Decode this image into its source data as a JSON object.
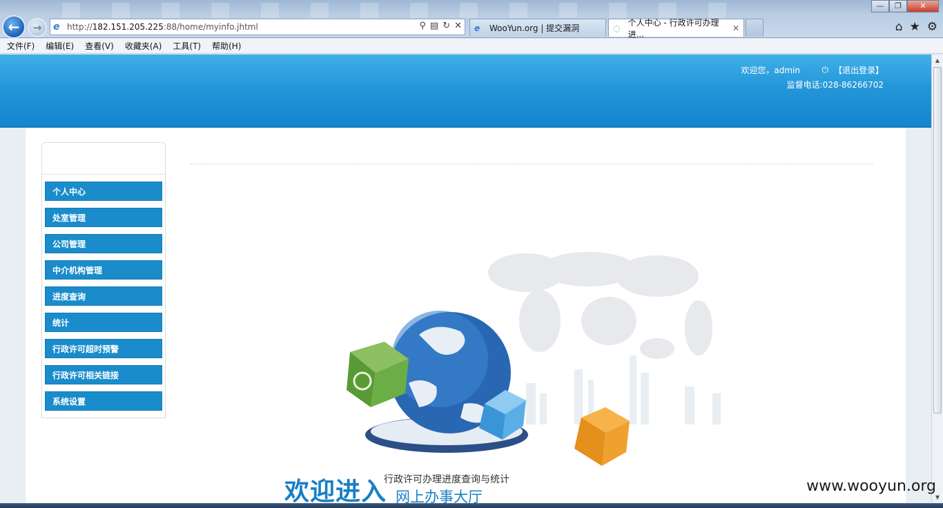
{
  "browser": {
    "address_url_prefix": "http://",
    "address_url_host": "182.151.205.225",
    "address_url_rest": ":88/home/myinfo.jhtml",
    "tabs": [
      {
        "label": "WooYun.org | 提交漏洞"
      },
      {
        "label": "个人中心 - 行政许可办理进..."
      }
    ],
    "menu": [
      "文件(F)",
      "编辑(E)",
      "查看(V)",
      "收藏夹(A)",
      "工具(T)",
      "帮助(H)"
    ],
    "window_buttons": {
      "minimize": "—",
      "restore": "❐",
      "close": "✕"
    }
  },
  "header": {
    "welcome": "欢迎您，admin",
    "logout": "【退出登录】",
    "phone": "监督电话:028-86266702"
  },
  "sidebar": {
    "items": [
      {
        "label": "个人中心"
      },
      {
        "label": "处室管理"
      },
      {
        "label": "公司管理"
      },
      {
        "label": "中介机构管理"
      },
      {
        "label": "进度查询"
      },
      {
        "label": "统计"
      },
      {
        "label": "行政许可超时预警"
      },
      {
        "label": "行政许可相关链接"
      },
      {
        "label": "系统设置"
      }
    ]
  },
  "banner": {
    "title": "欢迎进入",
    "subtitle1": "行政许可办理进度查询与统计",
    "subtitle2": "网上办事大厅"
  },
  "watermark": "www.wooyun.org",
  "colors": {
    "header_blue": "#1d8fd3",
    "sidebar_item": "#1a8ccb",
    "accent_text": "#1a7fc4"
  }
}
